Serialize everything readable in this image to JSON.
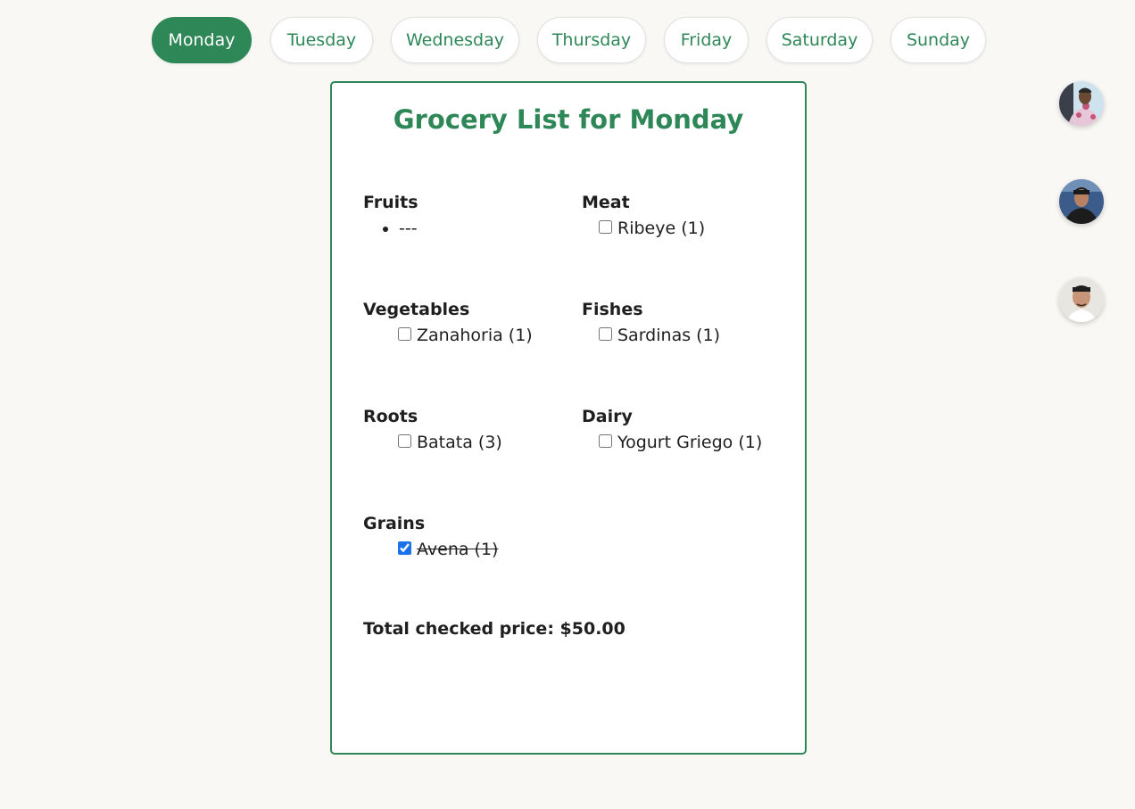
{
  "days": {
    "items": [
      "Monday",
      "Tuesday",
      "Wednesday",
      "Thursday",
      "Friday",
      "Saturday",
      "Sunday"
    ],
    "active": "Monday"
  },
  "card": {
    "title": "Grocery List for Monday",
    "categories": {
      "fruits": {
        "name": "Fruits",
        "empty_text": "---"
      },
      "meat": {
        "name": "Meat",
        "items": [
          {
            "text": "Ribeye (1)",
            "checked": false
          }
        ]
      },
      "vegetables": {
        "name": "Vegetables",
        "items": [
          {
            "text": "Zanahoria (1)",
            "checked": false
          }
        ]
      },
      "fishes": {
        "name": "Fishes",
        "items": [
          {
            "text": "Sardinas (1)",
            "checked": false
          }
        ]
      },
      "roots": {
        "name": "Roots",
        "items": [
          {
            "text": "Batata (3)",
            "checked": false
          }
        ]
      },
      "dairy": {
        "name": "Dairy",
        "items": [
          {
            "text": "Yogurt Griego (1)",
            "checked": false
          }
        ]
      },
      "grains": {
        "name": "Grains",
        "items": [
          {
            "text": "Avena (1)",
            "checked": true
          }
        ]
      }
    },
    "total": "Total checked price: $50.00"
  },
  "avatars": [
    {
      "name": "user-avatar-1",
      "colors": {
        "bg": "#cfe3ef",
        "skin": "#6b4a34",
        "shirt": "#e7c6d8",
        "hair": "#2a2a2a"
      }
    },
    {
      "name": "user-avatar-2",
      "colors": {
        "bg": "#3b5b8a",
        "skin": "#b88262",
        "shirt": "#1c1c1c",
        "hair": "#1a1a1a"
      }
    },
    {
      "name": "user-avatar-3",
      "colors": {
        "bg": "#e8e6e0",
        "skin": "#c89578",
        "shirt": "#ffffff",
        "hair": "#1e1e1e"
      }
    }
  ],
  "colors": {
    "accent": "#2e8757",
    "background": "#f9f8f5",
    "checkbox": "#1a73e8"
  }
}
